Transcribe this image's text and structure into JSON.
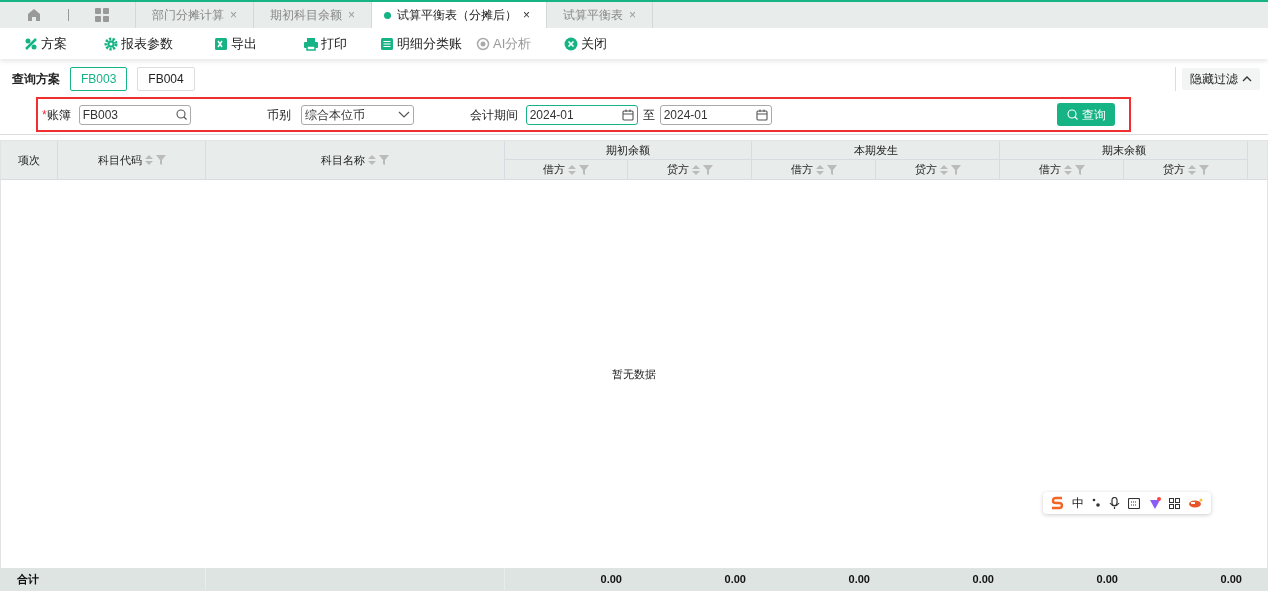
{
  "tabs": [
    {
      "label": "部门分摊计算",
      "selected": false,
      "close": "×"
    },
    {
      "label": "期初科目余额",
      "selected": false,
      "close": "×"
    },
    {
      "label": "试算平衡表（分摊后）",
      "selected": true,
      "close": "×"
    },
    {
      "label": "试算平衡表",
      "selected": false,
      "close": "×"
    }
  ],
  "toolbar": [
    {
      "label": "方案",
      "kind": "scheme",
      "disabled": false
    },
    {
      "label": "报表参数",
      "kind": "params",
      "disabled": false
    },
    {
      "label": "导出",
      "kind": "export",
      "disabled": false
    },
    {
      "label": "打印",
      "kind": "print",
      "disabled": false
    },
    {
      "label": "明细分类账",
      "kind": "ledger",
      "disabled": false
    },
    {
      "label": "AI分析",
      "kind": "ai",
      "disabled": true
    },
    {
      "label": "关闭",
      "kind": "close",
      "disabled": false
    }
  ],
  "query_schemes": {
    "label": "查询方案",
    "items": [
      {
        "label": "FB003",
        "selected": true
      },
      {
        "label": "FB004",
        "selected": false
      }
    ]
  },
  "hide_filter": "隐藏过滤",
  "filters": {
    "book": {
      "required_mark": "*",
      "label": "账簿",
      "value": "FB003"
    },
    "currency": {
      "label": "币别",
      "value": "综合本位币"
    },
    "period": {
      "label": "会计期间",
      "from": "2024-01",
      "separator": "至",
      "to": "2024-01"
    },
    "query_button": "查询"
  },
  "table": {
    "columns": [
      {
        "label": "项次",
        "sortable": false
      },
      {
        "label": "科目代码",
        "sortable": true
      },
      {
        "label": "科目名称",
        "sortable": true
      }
    ],
    "groups": [
      {
        "label": "期初余额",
        "columns": [
          "借方",
          "贷方"
        ]
      },
      {
        "label": "本期发生",
        "columns": [
          "借方",
          "贷方"
        ]
      },
      {
        "label": "期末余额",
        "columns": [
          "借方",
          "贷方"
        ]
      }
    ],
    "empty_text": "暂无数据",
    "footer": {
      "label": "合计",
      "totals": [
        "0.00",
        "0.00",
        "0.00",
        "0.00",
        "0.00",
        "0.00"
      ]
    }
  },
  "ime_toolbar": {
    "mode": "中"
  }
}
